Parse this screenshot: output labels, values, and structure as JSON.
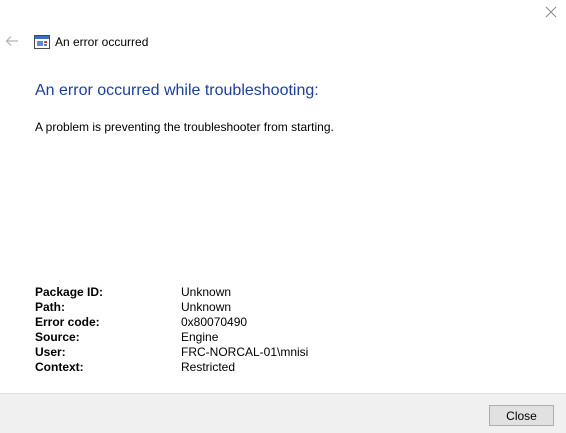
{
  "window": {
    "title": "An error occurred",
    "close_icon": "close-icon",
    "back_icon": "back-arrow-icon",
    "app_icon": "troubleshooter-window-icon"
  },
  "main": {
    "heading": "An error occurred while troubleshooting:",
    "description": "A problem is preventing the troubleshooter from starting."
  },
  "details": [
    {
      "label": "Package ID:",
      "value": "Unknown"
    },
    {
      "label": "Path:",
      "value": "Unknown"
    },
    {
      "label": "Error code:",
      "value": "0x80070490"
    },
    {
      "label": "Source:",
      "value": "Engine"
    },
    {
      "label": "User:",
      "value": "FRC-NORCAL-01\\mnisi"
    },
    {
      "label": "Context:",
      "value": "Restricted"
    }
  ],
  "footer": {
    "close_label": "Close"
  },
  "colors": {
    "heading": "#1e3e9c",
    "footer_background": "#f0f0f0",
    "button_background": "#e1e1e1"
  }
}
